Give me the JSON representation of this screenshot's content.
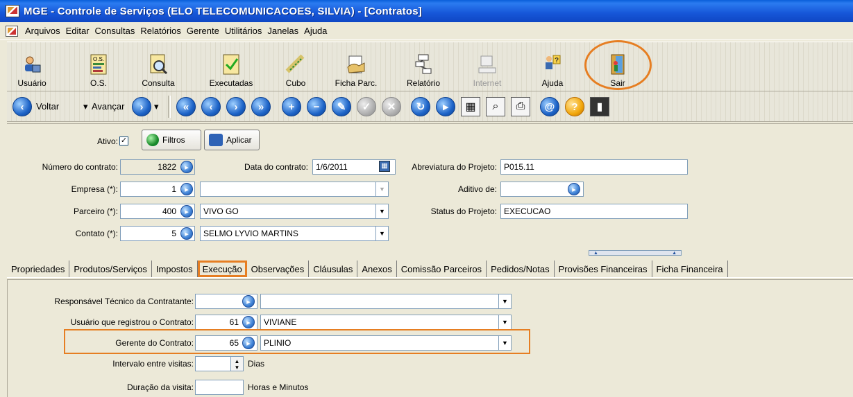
{
  "window": {
    "title": "MGE - Controle de Serviços (ELO TELECOMUNICACOES, SILVIA) - [Contratos]"
  },
  "menu": [
    "Arquivos",
    "Editar",
    "Consultas",
    "Relatórios",
    "Gerente",
    "Utilitários",
    "Janelas",
    "Ajuda"
  ],
  "toolbar": {
    "buttons": [
      {
        "label": "Usuário",
        "icon": "user-icon"
      },
      {
        "label": "O.S.",
        "icon": "os-icon"
      },
      {
        "label": "Consulta",
        "icon": "query-icon"
      },
      {
        "label": "Executadas",
        "icon": "executed-icon"
      },
      {
        "label": "Cubo",
        "icon": "cube-icon"
      },
      {
        "label": "Ficha Parc.",
        "icon": "partner-sheet-icon"
      },
      {
        "label": "Relatório",
        "icon": "report-icon"
      },
      {
        "label": "Internet",
        "icon": "internet-icon"
      },
      {
        "label": "Ajuda",
        "icon": "help-icon"
      },
      {
        "label": "Sair",
        "icon": "exit-icon"
      }
    ]
  },
  "nav": {
    "back": "Voltar",
    "forward": "Avançar"
  },
  "form": {
    "ativo_label": "Ativo:",
    "ativo_checked": "✓",
    "filtros_label": "Filtros",
    "aplicar_label": "Aplicar",
    "numero_label": "Número do contrato:",
    "numero_value": "1822",
    "data_label": "Data do contrato:",
    "data_value": "1/6/2011",
    "abrev_label": "Abreviatura do Projeto:",
    "abrev_value": "P015.11",
    "empresa_label": "Empresa (*):",
    "empresa_code": "1",
    "empresa_name": "",
    "aditivo_label": "Aditivo de:",
    "aditivo_value": "",
    "parceiro_label": "Parceiro (*):",
    "parceiro_code": "400",
    "parceiro_name": "VIVO GO",
    "status_label": "Status do Projeto:",
    "status_value": "EXECUCAO",
    "contato_label": "Contato (*):",
    "contato_code": "5",
    "contato_name": "SELMO LYVIO MARTINS"
  },
  "tabs": [
    "Propriedades",
    "Produtos/Serviços",
    "Impostos",
    "Execução",
    "Observações",
    "Cláusulas",
    "Anexos",
    "Comissão Parceiros",
    "Pedidos/Notas",
    "Provisões Financeiras",
    "Ficha Financeira"
  ],
  "active_tab": "Execução",
  "execucao": {
    "resp_label": "Responsável Técnico da Contratante:",
    "resp_code": "",
    "resp_name": "",
    "usuario_label": "Usuário que registrou o Contrato:",
    "usuario_code": "61",
    "usuario_name": "VIVIANE",
    "gerente_label": "Gerente do Contrato:",
    "gerente_code": "65",
    "gerente_name": "PLINIO",
    "intervalo_label": "Intervalo entre visitas:",
    "intervalo_unit": "Dias",
    "duracao_label": "Duração da visita:",
    "duracao_unit": "Horas e Minutos"
  }
}
